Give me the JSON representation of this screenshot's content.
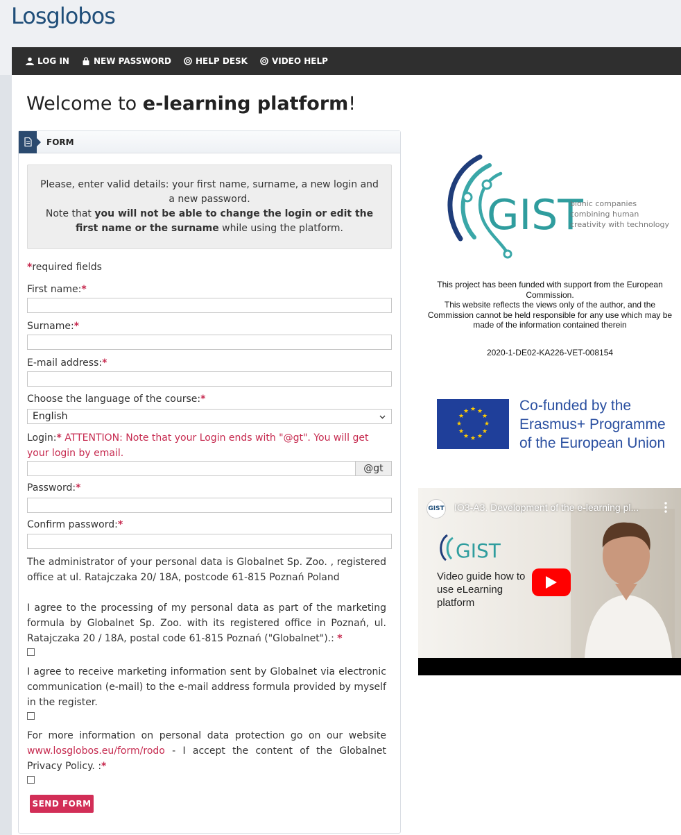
{
  "brand": {
    "logo_text": "Losglobos",
    "accent": "#d22e57",
    "nav_bg": "#2f2f2f",
    "panel_icon_bg": "#2b4a6f"
  },
  "nav": [
    {
      "label": "LOG IN",
      "icon": "user-icon"
    },
    {
      "label": "NEW PASSWORD",
      "icon": "lock-icon"
    },
    {
      "label": "HELP DESK",
      "icon": "lifebuoy-icon"
    },
    {
      "label": "VIDEO HELP",
      "icon": "lifebuoy-icon"
    }
  ],
  "welcome": {
    "prefix": "Welcome to ",
    "bold": "e-learning platform",
    "suffix": "!"
  },
  "form": {
    "panel_title": "FORM",
    "notice": {
      "line1": "Please, enter valid details: your first name, surname, a new login and a new password.",
      "note_prefix": "Note that ",
      "note_bold": "you will not be able to change the login or edit the first name or the surname",
      "note_suffix": " while using the platform."
    },
    "required_mark": "*",
    "required_text": "required fields",
    "first_name_label": "First name:",
    "surname_label": "Surname:",
    "email_label": "E-mail address:",
    "language_label": "Choose the language of the course:",
    "language_value": "English",
    "login_label": "Login:",
    "login_attention": "ATTENTION: Note that your Login ends with \"@gt\". You will get your login by email.",
    "login_suffix": "@gt",
    "password_label": "Password:",
    "confirm_label": "Confirm password:",
    "admin_text": "The administrator of your personal data is Globalnet Sp. Zoo. , registered office at ul. Ratajczaka 20/ 18A, postcode 61-815 Poznań Poland",
    "consent1_text": "I agree to the processing of my personal data as part of the marketing formula by Globalnet Sp. Zoo. with its registered office in Poznań, ul. Ratajczaka 20 / 18A, postal code 61-815 Poznań (\"Globalnet\").: ",
    "consent2_text": "I agree to receive marketing information sent by Globalnet via electronic communication (e-mail) to the e-mail address formula provided by myself in the register.",
    "consent3_prefix": "For more information on personal data protection go on our website ",
    "consent3_link": "www.losglobos.eu/form/rodo",
    "consent3_suffix": " - I accept the content of the Globalnet Privacy Policy. :",
    "send_label": "SEND FORM"
  },
  "sidebar": {
    "gist_word": "GIST",
    "gist_tagline_1": "bionic companies",
    "gist_tagline_2": "combining human",
    "gist_tagline_3": "creativity with technology",
    "funding_1": "This project has been funded with support from the European Commission.",
    "funding_2": "This website reflects the views only of the author, and the Commission cannot be held responsible for any use which may be made of the information contained therein",
    "grant_number": "2020-1-DE02-KA226-VET-008154",
    "eu_line1": "Co-funded by the",
    "eu_line2": "Erasmus+ Programme",
    "eu_line3": "of the European Union",
    "video_title": "IO3-A3. Development of the e-learning pl...",
    "video_channel": "GIST",
    "video_caption_1": "Video guide how to",
    "video_caption_2": "use eLearning",
    "video_caption_3": "platform"
  }
}
